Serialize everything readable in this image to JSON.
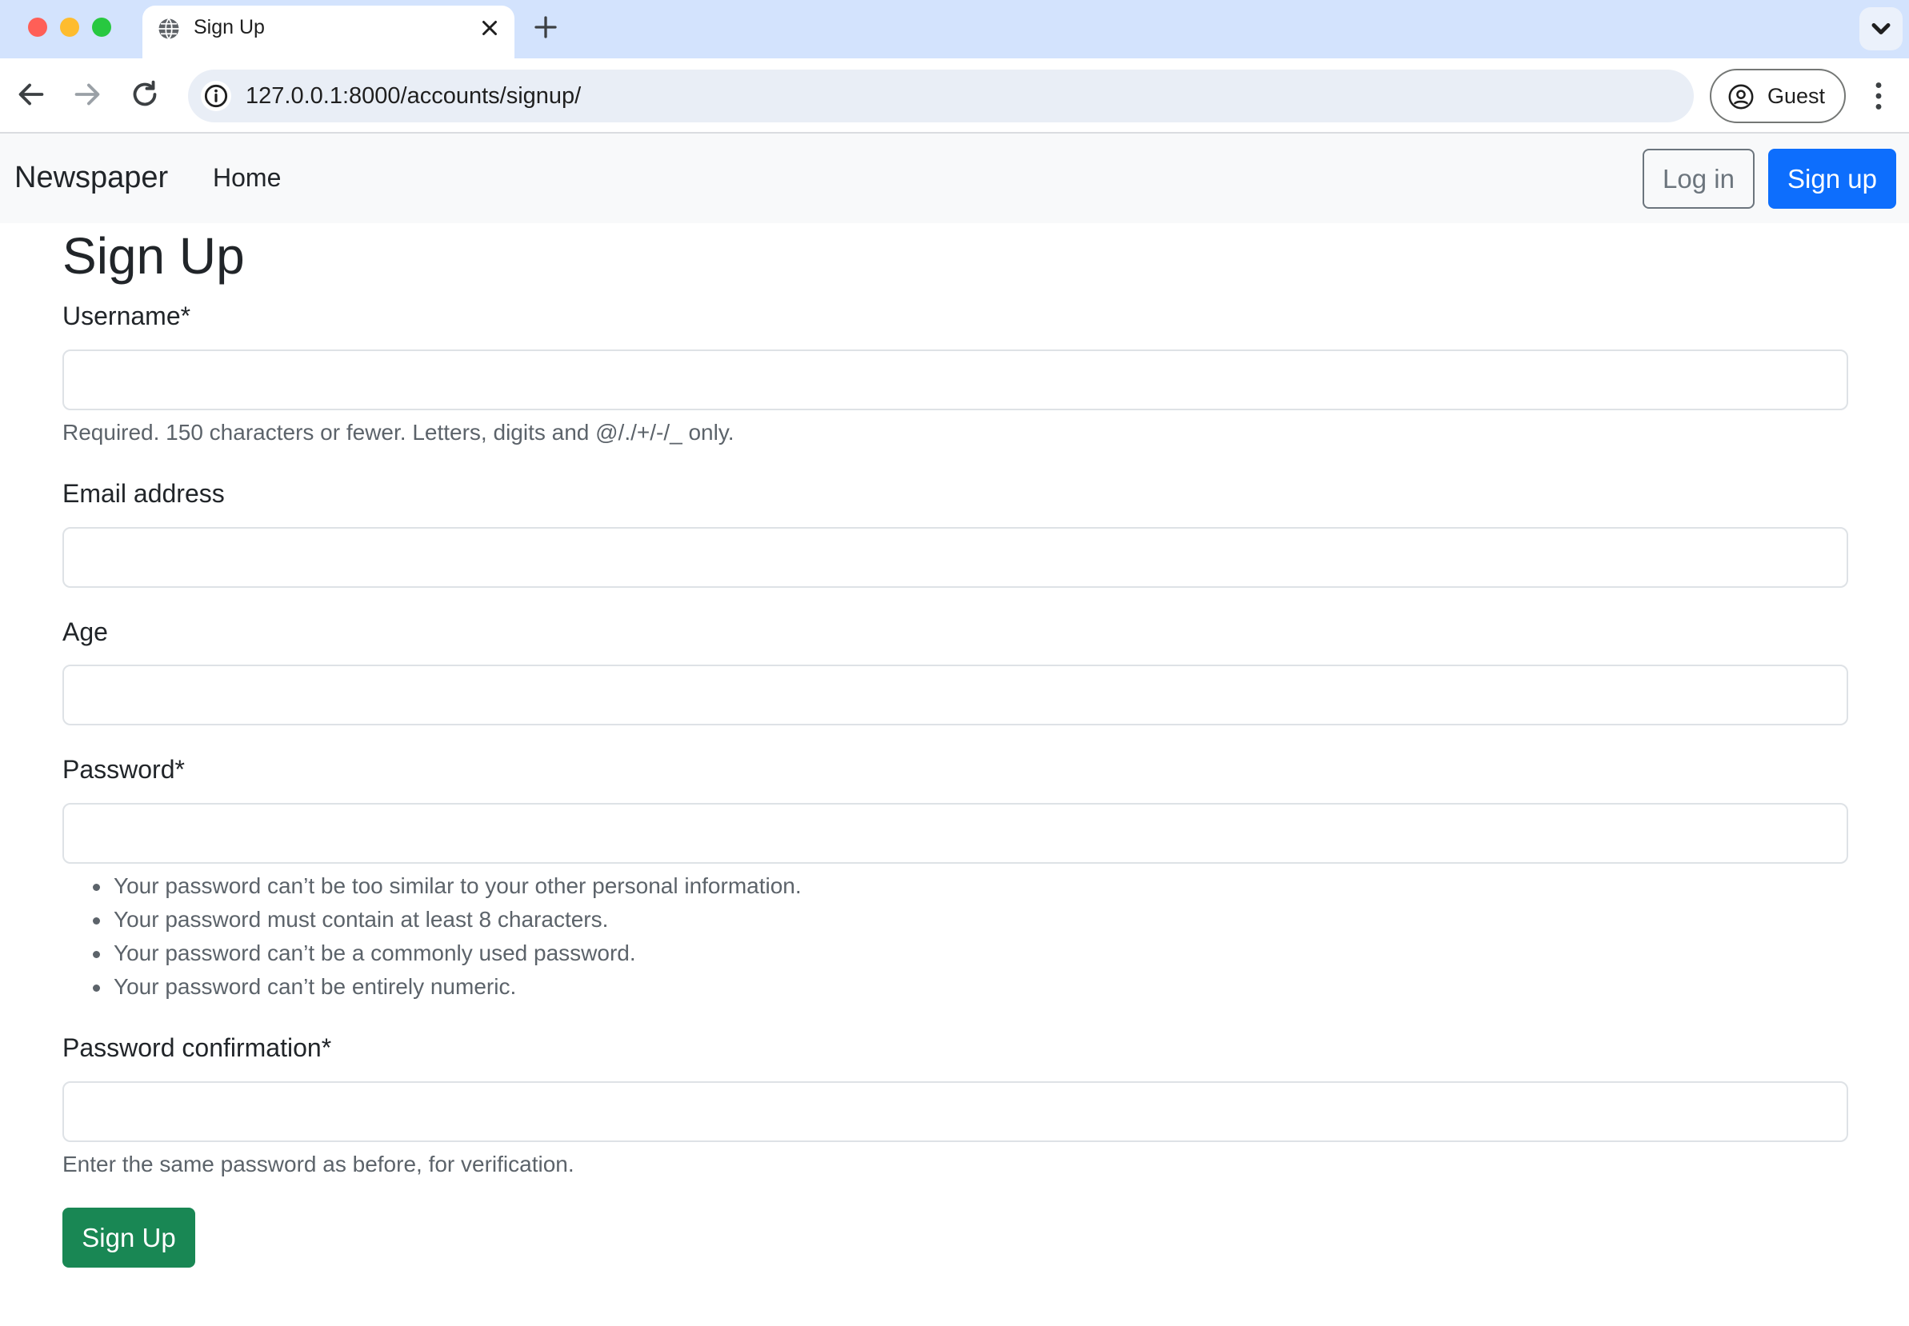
{
  "browser": {
    "tab_title": "Sign Up",
    "url": "127.0.0.1:8000/accounts/signup/",
    "profile_label": "Guest",
    "icons": {
      "close": "close-icon",
      "new_tab": "plus-icon",
      "back": "arrow-left-icon",
      "forward": "arrow-right-icon",
      "reload": "reload-icon",
      "info": "info-icon",
      "profile": "account-circle-icon",
      "menu": "kebab-menu-icon",
      "tab_search": "chevron-down-icon",
      "favicon": "globe-icon"
    }
  },
  "navbar": {
    "brand": "Newspaper",
    "home": "Home",
    "login": "Log in",
    "signup": "Sign up"
  },
  "form": {
    "title": "Sign Up",
    "username": {
      "label": "Username*",
      "value": "",
      "help": "Required. 150 characters or fewer. Letters, digits and @/./+/-/_ only."
    },
    "email": {
      "label": "Email address",
      "value": ""
    },
    "age": {
      "label": "Age",
      "value": ""
    },
    "password": {
      "label": "Password*",
      "value": "",
      "help": [
        "Your password can’t be too similar to your other personal information.",
        "Your password must contain at least 8 characters.",
        "Your password can’t be a commonly used password.",
        "Your password can’t be entirely numeric."
      ]
    },
    "password_confirmation": {
      "label": "Password confirmation*",
      "value": "",
      "help": "Enter the same password as before, for verification."
    },
    "submit": "Sign Up"
  },
  "colors": {
    "primary": "#0d6efd",
    "success": "#198754",
    "secondary": "#6c757d",
    "navbar_bg": "#f8f9fa",
    "tabstrip_bg": "#d3e3fd"
  }
}
